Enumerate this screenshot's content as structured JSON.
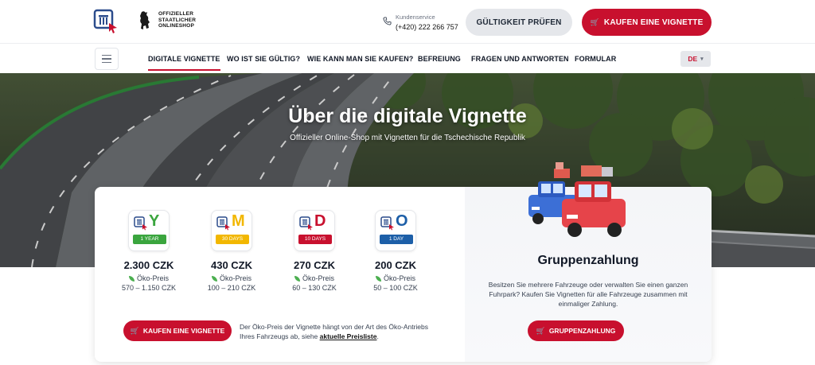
{
  "header": {
    "official_lines": [
      "OFFIZIELLER",
      "STAATLICHER",
      "ONLINESHOP"
    ],
    "contact_label": "Kundenservice",
    "contact_phone": "(+420) 222 266 757",
    "check_button": "GÜLTIGKEIT PRÜFEN",
    "buy_button": "KAUFEN EINE VIGNETTE"
  },
  "nav": {
    "items": [
      "DIGITALE VIGNETTE",
      "WO IST SIE GÜLTIG?",
      "WIE KANN MAN SIE KAUFEN?",
      "BEFREIUNG",
      "FRAGEN UND ANTWORTEN",
      "FORMULAR"
    ],
    "active": "DIGITALE VIGNETTE",
    "language": "DE"
  },
  "hero": {
    "title": "Über die digitale Vignette",
    "subtitle": "Offizieller Online-Shop mit Vignetten für die Tschechische Republik"
  },
  "vignettes": [
    {
      "letter": "Y",
      "tag": "1 YEAR",
      "color": "#3aa53e",
      "price": "2.300 CZK",
      "eco_label": "Öko-Preis",
      "eco_range": "570 – 1.150 CZK"
    },
    {
      "letter": "M",
      "tag": "30 DAYS",
      "color": "#f2b700",
      "price": "430 CZK",
      "eco_label": "Öko-Preis",
      "eco_range": "100 – 210 CZK"
    },
    {
      "letter": "D",
      "tag": "10 DAYS",
      "color": "#c8102e",
      "price": "270 CZK",
      "eco_label": "Öko-Preis",
      "eco_range": "60 – 130 CZK"
    },
    {
      "letter": "O",
      "tag": "1 DAY",
      "color": "#1d5fa8",
      "price": "200 CZK",
      "eco_label": "Öko-Preis",
      "eco_range": "50 – 100 CZK"
    }
  ],
  "card": {
    "buy_button": "KAUFEN EINE VIGNETTE",
    "note_text": "Der Öko-Preis der Vignette hängt von der Art des Öko-Antriebs Ihres Fahrzeugs ab, siehe ",
    "note_link": "aktuelle Preisliste",
    "note_end": ".",
    "group_title": "Gruppenzahlung",
    "group_text": "Besitzen Sie mehrere Fahrzeuge oder verwalten Sie einen ganzen Fuhrpark? Kaufen Sie Vignetten für alle Fahrzeuge zusammen mit einmaliger Zahlung.",
    "group_button": "GRUPPENZAHLUNG"
  },
  "colors": {
    "accent": "#c8102e",
    "logo_blue": "#2b4c8c"
  },
  "icons": [
    "menu-icon",
    "phone-icon",
    "cart-icon",
    "leaf-icon",
    "chevron-down-icon"
  ]
}
